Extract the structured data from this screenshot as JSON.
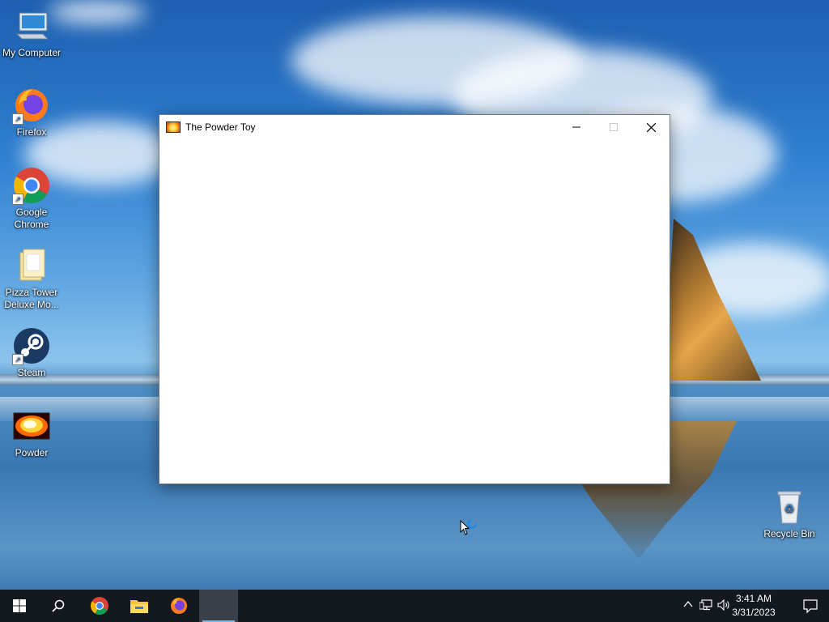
{
  "desktop": {
    "icons": [
      {
        "label": "My Computer",
        "icon": "computer-icon",
        "shortcut": false
      },
      {
        "label": "Firefox",
        "icon": "firefox-icon",
        "shortcut": true
      },
      {
        "label": "Google Chrome",
        "icon": "chrome-icon",
        "shortcut": true
      },
      {
        "label": "Pizza Tower Deluxe Mo...",
        "icon": "folder-icon",
        "shortcut": false
      },
      {
        "label": "Steam",
        "icon": "steam-icon",
        "shortcut": true
      },
      {
        "label": "Powder",
        "icon": "powder-icon",
        "shortcut": false
      },
      {
        "label": "Recycle Bin",
        "icon": "recycle-bin-icon",
        "shortcut": false
      }
    ]
  },
  "window": {
    "title": "The Powder Toy",
    "controls": {
      "minimize": "minimize-icon",
      "maximize": "maximize-icon",
      "close": "close-icon"
    }
  },
  "taskbar": {
    "apps": [
      "start-icon",
      "search-icon",
      "chrome-icon",
      "file-explorer-icon",
      "firefox-icon",
      "powder-toy-taskbar"
    ],
    "active_app": "The Powder Toy",
    "accent": "#7ab3e8",
    "tray_icons": [
      "chevron-up-icon",
      "network-icon",
      "volume-icon",
      "notification-icon"
    ],
    "time": "3:41 AM",
    "date": "3/31/2023"
  }
}
